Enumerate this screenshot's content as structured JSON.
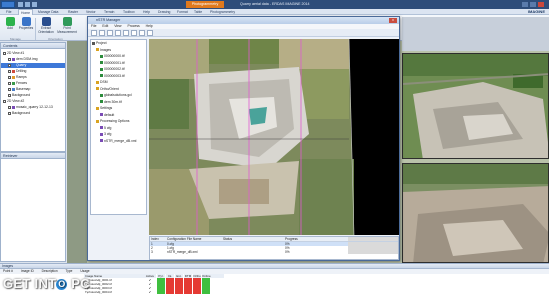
{
  "titlebar": {
    "highlight_tab": "Photogrammetry",
    "doc_title": "Quarry aerial data - ERDAS IMAGINE 2014"
  },
  "ribbon_tabs": [
    "File",
    "Home",
    "Manage Data",
    "Raster",
    "Vector",
    "Terrain",
    "Toolbox",
    "Help",
    "Drawing",
    "Format",
    "Table",
    "Photogrammetry"
  ],
  "brand": "IMAGINE",
  "ribbon": {
    "buttons": [
      {
        "label": "Add",
        "icon": "add-icon",
        "color": "#2bb24c"
      },
      {
        "label": "Properties",
        "icon": "properties-icon",
        "color": "#3a74c8"
      },
      {
        "label": "Extract Orientation",
        "icon": "orientation-icon",
        "color": "#2a4f8f"
      },
      {
        "label": "Point Measurement",
        "icon": "point-measurement-icon",
        "color": "#2f9a5a"
      }
    ],
    "groups": [
      "Manage",
      "Orientation"
    ]
  },
  "contents_panel": {
    "title": "Contents",
    "items": [
      {
        "label": "2D View #1",
        "level": 0,
        "color": ""
      },
      {
        "label": "dem DSM.img",
        "level": 1,
        "color": "#7a4bb5"
      },
      {
        "label": "Quarry",
        "level": 1,
        "color": "#3d78d8",
        "selected": true
      },
      {
        "label": "Drilling",
        "level": 1,
        "color": "#d24a3c"
      },
      {
        "label": "Ramps",
        "level": 1,
        "color": "#e09a2a"
      },
      {
        "label": "Fences",
        "level": 1,
        "color": "#3a9a4a"
      },
      {
        "label": "Basemap",
        "level": 1,
        "color": "#4a7ec8"
      },
      {
        "label": "Background",
        "level": 1,
        "color": ""
      },
      {
        "label": "2D View #2",
        "level": 0,
        "color": ""
      },
      {
        "label": "mosaic_quarry 12-12-13",
        "level": 1,
        "color": "#7a4bb5"
      },
      {
        "label": "Background",
        "level": 1,
        "color": ""
      }
    ]
  },
  "retriever_panel": {
    "title": "Retriever"
  },
  "dialog": {
    "title": "nSTR Manager",
    "close": "x",
    "menu": [
      "File",
      "Edit",
      "View",
      "Process",
      "Help"
    ],
    "tree": [
      {
        "label": "Project",
        "level": 0,
        "color": "#555"
      },
      {
        "label": "Images",
        "level": 1,
        "color": "#d9a321"
      },
      {
        "label": "000000000.tif",
        "level": 2,
        "color": "#2c8c3c"
      },
      {
        "label": "000000001.tif",
        "level": 2,
        "color": "#2c8c3c"
      },
      {
        "label": "000000002.tif",
        "level": 2,
        "color": "#2c8c3c"
      },
      {
        "label": "000000003.tif",
        "level": 2,
        "color": "#2c8c3c"
      },
      {
        "label": "DSM",
        "level": 1,
        "color": "#d9a321"
      },
      {
        "label": "Ortho/Orient",
        "level": 1,
        "color": "#d9a321"
      },
      {
        "label": "globalsolutions.gcl",
        "level": 2,
        "color": "#2c8c3c"
      },
      {
        "label": "dem 30m.tif",
        "level": 2,
        "color": "#2c8c3c"
      },
      {
        "label": "Settings",
        "level": 1,
        "color": "#d9a321"
      },
      {
        "label": "default",
        "level": 2,
        "color": "#7a4bb5"
      },
      {
        "label": "Processing Options",
        "level": 1,
        "color": "#d9a321"
      },
      {
        "label": "5 cfg",
        "level": 2,
        "color": "#7a4bb5"
      },
      {
        "label": "3 cfg",
        "level": 2,
        "color": "#7a4bb5"
      },
      {
        "label": "nSTR_merge_dB.xml",
        "level": 2,
        "color": "#7a4bb5"
      }
    ],
    "table": {
      "headers": [
        "Index",
        "Configuration File Name",
        "Status",
        "Progress"
      ],
      "rows": [
        [
          "1",
          "0.cfg",
          "",
          "0%"
        ],
        [
          "2",
          "1.cfg",
          "",
          "0%"
        ],
        [
          "3",
          "nSTR_merge_dB.xml",
          "",
          "0%"
        ]
      ]
    }
  },
  "bottom_panel": {
    "title": "Images",
    "tabs": [
      "Point #",
      "Image ID",
      "Description",
      "Type",
      "Usage"
    ],
    "grid_headers": [
      "Image Name",
      "Active",
      "Pyr.",
      "Int.",
      "Ext.",
      "DTM",
      "Ortho",
      "Online"
    ],
    "rows": [
      {
        "name": "f:\\photos\\dji_0001.tif",
        "active": "✔"
      },
      {
        "name": "f:\\photos\\dji_0002.tif",
        "active": "✔"
      },
      {
        "name": "f:\\photos\\dji_0003.tif",
        "active": "✔"
      },
      {
        "name": "f:\\photos\\dji_0004.tif",
        "active": "✔"
      }
    ]
  },
  "watermark": {
    "prefix": "GET INT",
    "o": "O",
    "suffix": " PC"
  }
}
